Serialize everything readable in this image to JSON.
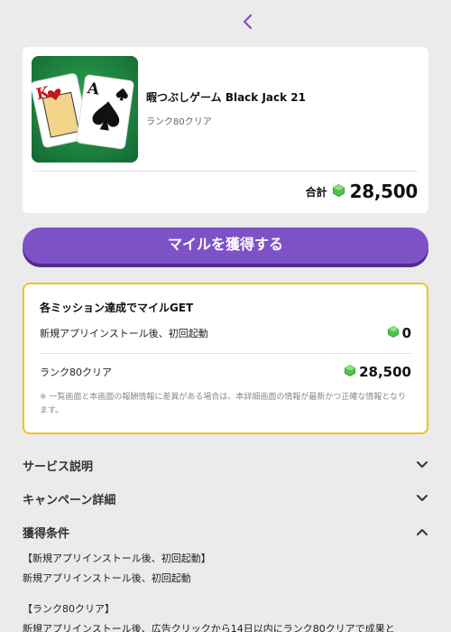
{
  "nav": {
    "back_icon": "chevron-left-icon",
    "accent_color": "#7e52c7"
  },
  "offer": {
    "title": "暇つぶしゲーム Black Jack 21",
    "subtitle": "ランク80クリア",
    "total_label": "合計",
    "total_value": "28,500",
    "thumbnail_card_ranks": [
      "K",
      "A"
    ]
  },
  "cta": {
    "label": "マイルを獲得する"
  },
  "mission": {
    "title": "各ミッション達成でマイルGET",
    "rows": [
      {
        "label": "新規アプリインストール後、初回起動",
        "value": "0"
      },
      {
        "label": "ランク80クリア",
        "value": "28,500"
      }
    ],
    "note": "※ 一覧画面と本画面の報酬情報に差異がある場合は、本詳細画面の情報が最新かつ正確な情報となります。"
  },
  "accordions": [
    {
      "label": "サービス説明",
      "state": "collapsed"
    },
    {
      "label": "キャンペーン詳細",
      "state": "collapsed"
    },
    {
      "label": "獲得条件",
      "state": "expanded"
    }
  ],
  "conditions": {
    "h1": "【新規アプリインストール後、初回起動】",
    "p1": "新規アプリインストール後、初回起動",
    "h2": "【ランク80クリア】",
    "p2": "新規アプリインストール後、広告クリックから14日以内にランク80クリアで成果と"
  }
}
